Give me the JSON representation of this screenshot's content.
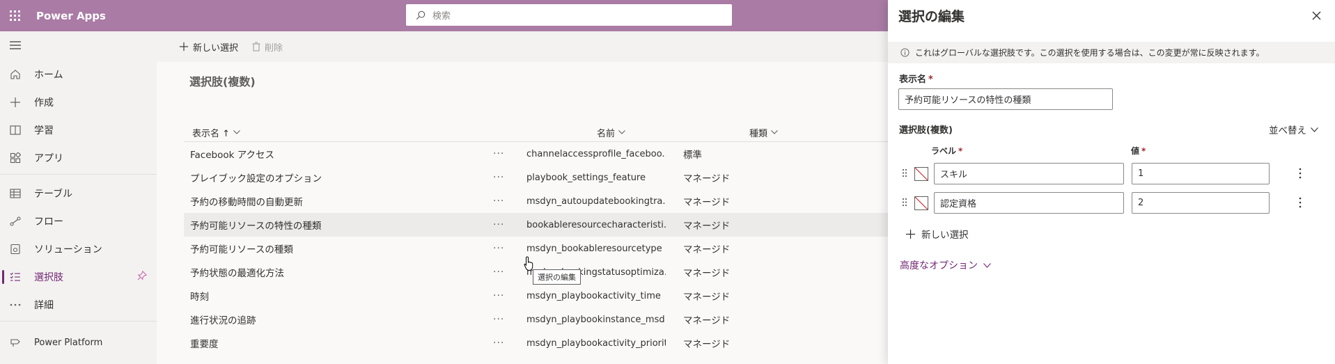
{
  "app": {
    "title": "Power Apps"
  },
  "search": {
    "placeholder": "検索"
  },
  "sidebar": {
    "items": [
      {
        "label": "ホーム",
        "icon": "home-icon"
      },
      {
        "label": "作成",
        "icon": "plus-icon"
      },
      {
        "label": "学習",
        "icon": "book-icon"
      },
      {
        "label": "アプリ",
        "icon": "apps-icon"
      },
      {
        "label": "テーブル",
        "icon": "table-icon"
      },
      {
        "label": "フロー",
        "icon": "flow-icon"
      },
      {
        "label": "ソリューション",
        "icon": "solution-icon"
      },
      {
        "label": "選択肢",
        "icon": "choices-icon",
        "active": true
      },
      {
        "label": "詳細",
        "icon": "more-icon"
      }
    ],
    "footer": {
      "label": "Power Platform",
      "icon": "power-platform-icon"
    }
  },
  "commandbar": {
    "new_label": "新しい選択",
    "delete_label": "削除"
  },
  "list": {
    "title": "選択肢(複数)",
    "columns": {
      "display_name": "表示名 ↑",
      "name": "名前",
      "type": "種類"
    },
    "rows": [
      {
        "display": "Facebook アクセス",
        "name": "channelaccessprofile_faceboo...",
        "type": "標準"
      },
      {
        "display": "プレイブック設定のオプション",
        "name": "playbook_settings_feature",
        "type": "マネージド"
      },
      {
        "display": "予約の移動時間の自動更新",
        "name": "msdyn_autoupdatebookingtra...",
        "type": "マネージド"
      },
      {
        "display": "予約可能リソースの特性の種類",
        "name": "bookableresourcecharacteristi...",
        "type": "マネージド"
      },
      {
        "display": "予約可能リソースの種類",
        "name": "msdyn_bookableresourcetype",
        "type": "マネージド"
      },
      {
        "display": "予約状態の最適化方法",
        "name": "msdyn_bookingstatusoptimiza...",
        "type": "マネージド"
      },
      {
        "display": "時刻",
        "name": "msdyn_playbookactivity_time",
        "type": "マネージド"
      },
      {
        "display": "進行状況の追跡",
        "name": "msdyn_playbookinstance_msd...",
        "type": "マネージド"
      },
      {
        "display": "重要度",
        "name": "msdyn_playbookactivity_priority",
        "type": "マネージド"
      }
    ],
    "tooltip": "選択の編集"
  },
  "panel": {
    "title": "選択の編集",
    "info": "これはグローバルな選択肢です。この選択を使用する場合は、この変更が常に反映されます。",
    "display_name_label": "表示名",
    "display_name_value": "予約可能リソースの特性の種類",
    "choices_label": "選択肢(複数)",
    "sort_label": "並べ替え",
    "label_header": "ラベル",
    "value_header": "値",
    "options": [
      {
        "label": "スキル",
        "value": "1"
      },
      {
        "label": "認定資格",
        "value": "2"
      }
    ],
    "add_option_label": "新しい選択",
    "advanced_label": "高度なオプション",
    "required_mark": "*"
  },
  "colors": {
    "topbar": "#a97ba5",
    "accent": "#742774"
  }
}
